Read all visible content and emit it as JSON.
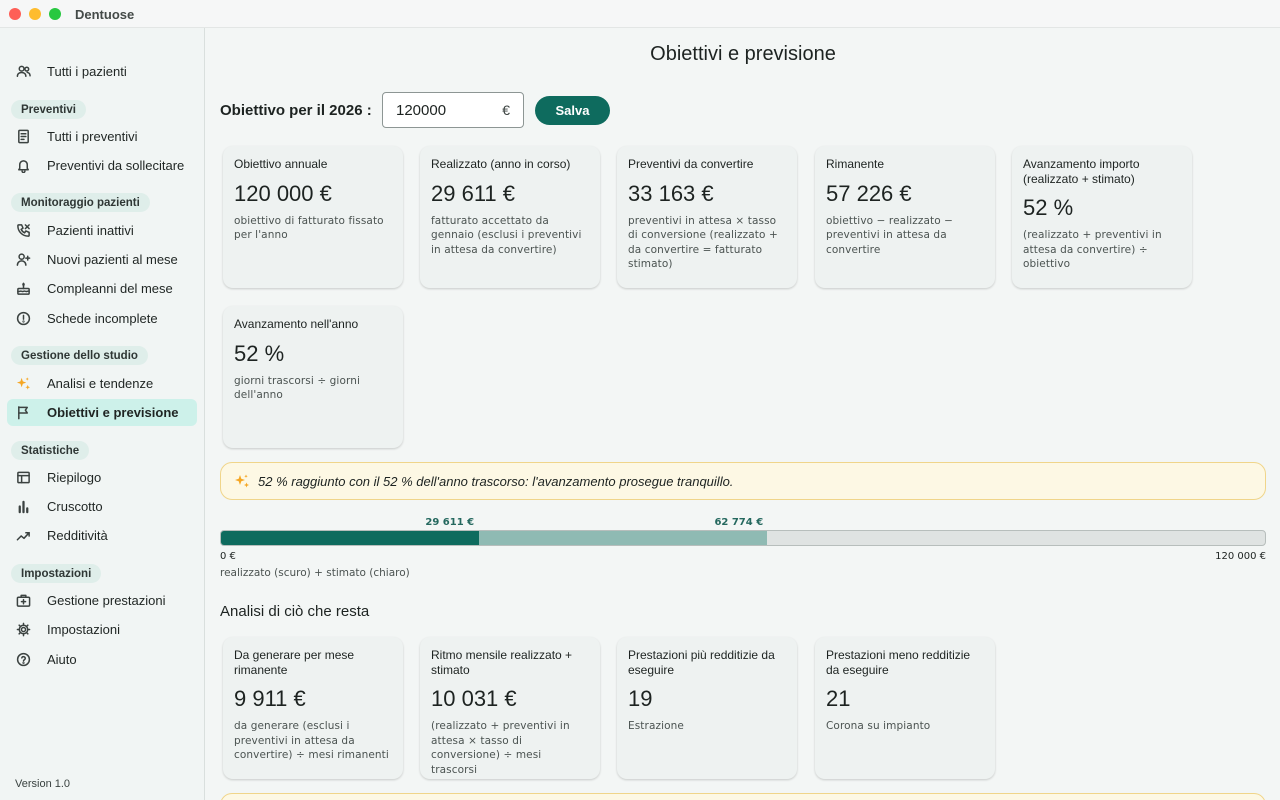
{
  "window": {
    "app_title": "Dentuose"
  },
  "sidebar": {
    "top_item": {
      "label": "Tutti i pazienti",
      "icon": "users-icon"
    },
    "sections": [
      {
        "title": "Preventivi",
        "items": [
          {
            "label": "Tutti i preventivi",
            "icon": "receipt-icon"
          },
          {
            "label": "Preventivi da sollecitare",
            "icon": "bell-icon"
          }
        ]
      },
      {
        "title": "Monitoraggio pazienti",
        "items": [
          {
            "label": "Pazienti inattivi",
            "icon": "phone-icon"
          },
          {
            "label": "Nuovi pazienti al mese",
            "icon": "user-plus-icon"
          },
          {
            "label": "Compleanni del mese",
            "icon": "cake-icon"
          },
          {
            "label": "Schede incomplete",
            "icon": "alert-circle-icon"
          }
        ]
      },
      {
        "title": "Gestione dello studio",
        "items": [
          {
            "label": "Analisi e tendenze",
            "icon": "sparkles-icon"
          },
          {
            "label": "Obiettivi e previsione",
            "icon": "flag-icon",
            "active": true
          }
        ]
      },
      {
        "title": "Statistiche",
        "items": [
          {
            "label": "Riepilogo",
            "icon": "table-icon"
          },
          {
            "label": "Cruscotto",
            "icon": "bar-chart-icon"
          },
          {
            "label": "Redditività",
            "icon": "trend-icon"
          }
        ]
      },
      {
        "title": "Impostazioni",
        "items": [
          {
            "label": "Gestione prestazioni",
            "icon": "medical-kit-icon"
          },
          {
            "label": "Impostazioni",
            "icon": "gear-icon"
          },
          {
            "label": "Aiuto",
            "icon": "help-icon"
          }
        ]
      }
    ],
    "version": "Version 1.0"
  },
  "main": {
    "page_title": "Obiettivi e previsione",
    "goal": {
      "label": "Obiettivo per il 2026 :",
      "value": "120000",
      "currency": "€",
      "save_label": "Salva"
    },
    "cards": [
      {
        "title": "Obiettivo annuale",
        "value": "120 000 €",
        "desc": "obiettivo di fatturato fissato per l'anno"
      },
      {
        "title": "Realizzato (anno in corso)",
        "value": "29 611 €",
        "desc": "fatturato accettato da gennaio (esclusi i preventivi in attesa da convertire)"
      },
      {
        "title": "Preventivi da convertire",
        "value": "33 163 €",
        "desc": "preventivi in attesa × tasso di conversione (realizzato + da convertire = fatturato stimato)"
      },
      {
        "title": "Rimanente",
        "value": "57 226 €",
        "desc": "obiettivo − realizzato − preventivi in attesa da convertire"
      },
      {
        "title": "Avanzamento importo (realizzato + stimato)",
        "value": "52 %",
        "desc": "(realizzato + preventivi in attesa da convertire) ÷ obiettivo"
      },
      {
        "title": "Avanzamento nell'anno",
        "value": "52 %",
        "desc": "giorni trascorsi ÷ giorni dell'anno"
      }
    ],
    "insight": "52 % raggiunto con il 52 % dell'anno trascorso: l'avanzamento prosegue tranquillo.",
    "progress": {
      "realized_label": "29 611 €",
      "estimated_label": "62 774 €",
      "realized_value": 29611,
      "estimated_value": 62774,
      "goal_value": 120000,
      "min_label": "0 €",
      "max_label": "120 000 €",
      "caption": "realizzato (scuro) + stimato (chiaro)",
      "colors": {
        "realized": "#0e6b5e",
        "estimated": "#8fbab3",
        "track": "#dfe3e2"
      }
    },
    "remaining_section": {
      "title": "Analisi di ciò che resta",
      "cards": [
        {
          "title": "Da generare per mese rimanente",
          "value": "9 911 €",
          "desc": "da generare (esclusi i preventivi in attesa da convertire) ÷ mesi rimanenti"
        },
        {
          "title": "Ritmo mensile realizzato + stimato",
          "value": "10 031 €",
          "desc": "(realizzato + preventivi in attesa × tasso di conversione) ÷ mesi trascorsi"
        },
        {
          "title": "Prestazioni più redditizie da eseguire",
          "value": "19",
          "desc": "Estrazione"
        },
        {
          "title": "Prestazioni meno redditizie da eseguire",
          "value": "21",
          "desc": "Corona su impianto"
        }
      ]
    }
  }
}
